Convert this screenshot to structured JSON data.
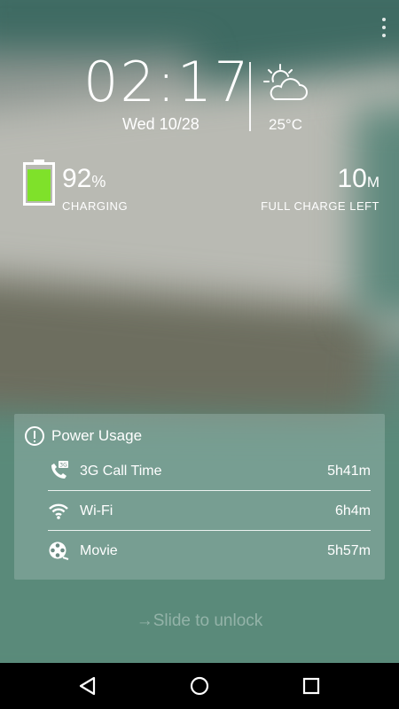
{
  "lockscreen": {
    "clock": "02:17",
    "date": "Wed 10/28",
    "weather": {
      "icon": "sun-behind-cloud-icon",
      "temperature": "25°C"
    }
  },
  "battery": {
    "percent_value": "92",
    "percent_unit": "%",
    "level": 0.92,
    "state": "CHARGING",
    "full_charge_value": "10",
    "full_charge_unit": "M",
    "full_charge_label": "FULL CHARGE LEFT",
    "fill_color": "#7fe12a"
  },
  "power_usage": {
    "title": "Power Usage",
    "items": [
      {
        "icon": "phone-3g-icon",
        "label": "3G Call Time",
        "value": "5h41m"
      },
      {
        "icon": "wifi-icon",
        "label": "Wi-Fi",
        "value": "6h4m"
      },
      {
        "icon": "movie-reel-icon",
        "label": "Movie",
        "value": "5h57m"
      }
    ]
  },
  "slide_to_unlock": {
    "arrow": "→",
    "text": "Slide to unlock"
  },
  "navbar": {
    "back": "back-icon",
    "home": "home-icon",
    "recents": "recents-icon"
  }
}
